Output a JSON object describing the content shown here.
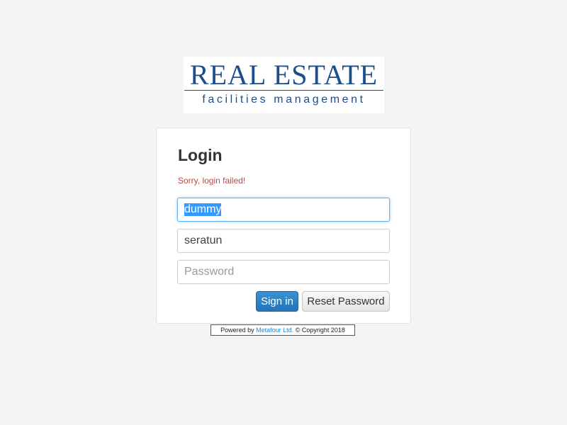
{
  "logo": {
    "title": "REAL ESTATE",
    "subtitle": "facilities management"
  },
  "login": {
    "title": "Login",
    "error": "Sorry, login failed!",
    "username_value": "dummy",
    "organisation_value": "seratun",
    "password_placeholder": "Password",
    "signin_label": "Sign in",
    "reset_label": "Reset Password"
  },
  "footer": {
    "prefix": "Powered by",
    "company": "Metafour Ltd.",
    "copyright": "© Copyright 2018"
  },
  "colors": {
    "brand": "#1b4e8c",
    "primary_button": "#2373b8",
    "error": "#b94a48",
    "link": "#2a7fc7"
  }
}
